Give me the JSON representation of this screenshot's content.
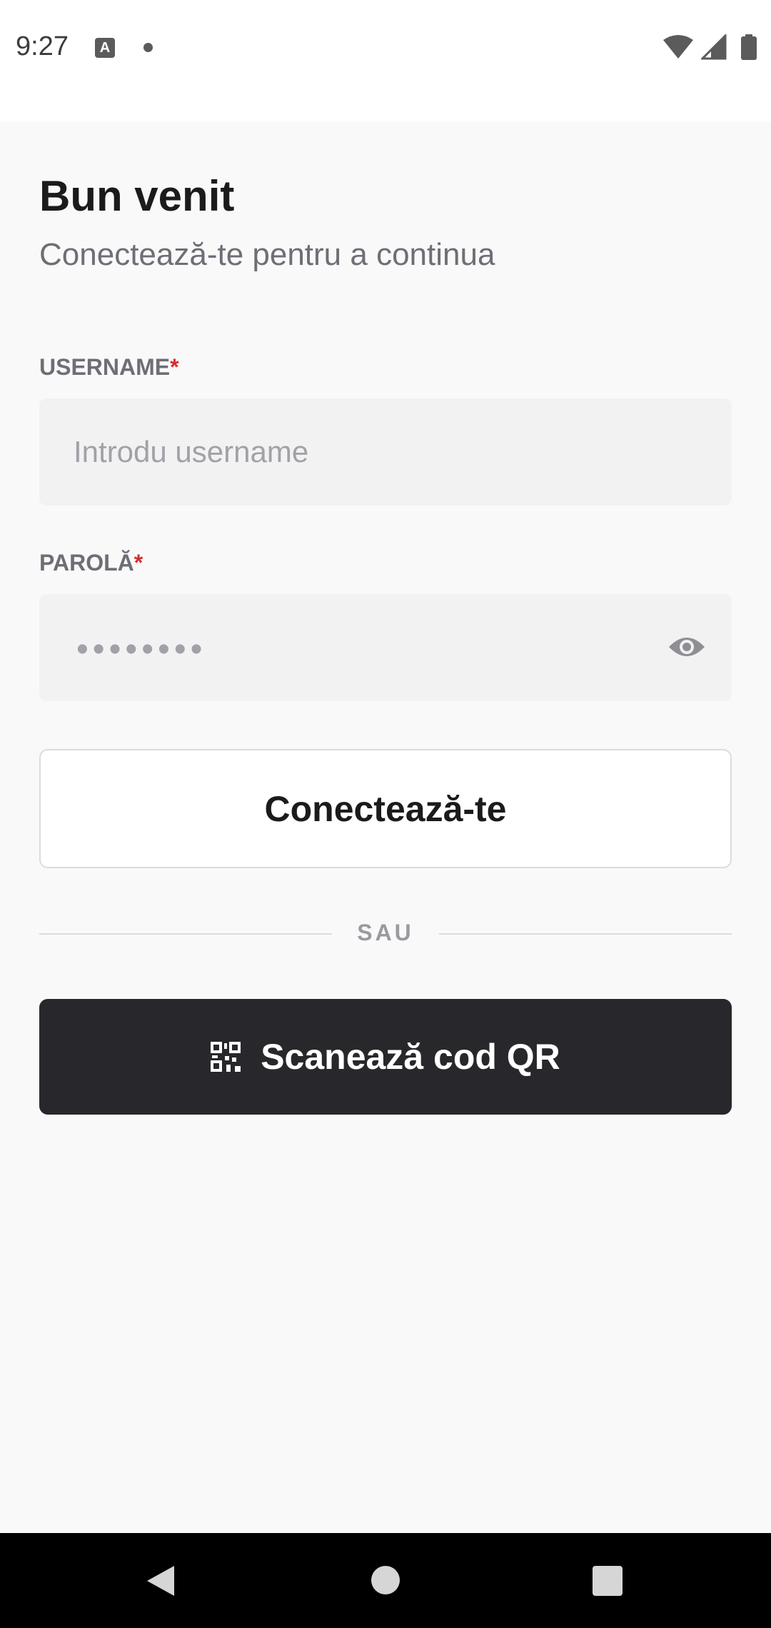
{
  "status_bar": {
    "time": "9:27",
    "notification_icon_letter": "A",
    "icons": [
      "wifi-icon",
      "signal-icon",
      "battery-icon"
    ]
  },
  "header": {
    "title": "Bun venit",
    "subtitle": "Conectează-te pentru a continua"
  },
  "form": {
    "username": {
      "label": "USERNAME",
      "required_mark": "*",
      "placeholder": "Introdu username",
      "value": ""
    },
    "password": {
      "label": "PAROLĂ",
      "required_mark": "*",
      "masked_value": "••••••••",
      "toggle_icon": "eye-icon"
    },
    "login_button": "Conectează-te",
    "divider": "SAU",
    "qr_button": "Scanează cod QR",
    "qr_icon": "qr-code-icon"
  },
  "colors": {
    "background": "#f9f9f9",
    "primary_dark": "#28282c",
    "required": "#d32f2f",
    "muted_text": "#6e6e76",
    "input_bg": "#f2f2f2"
  },
  "nav_bar": {
    "buttons": [
      "back-icon",
      "home-icon",
      "recents-icon"
    ]
  }
}
